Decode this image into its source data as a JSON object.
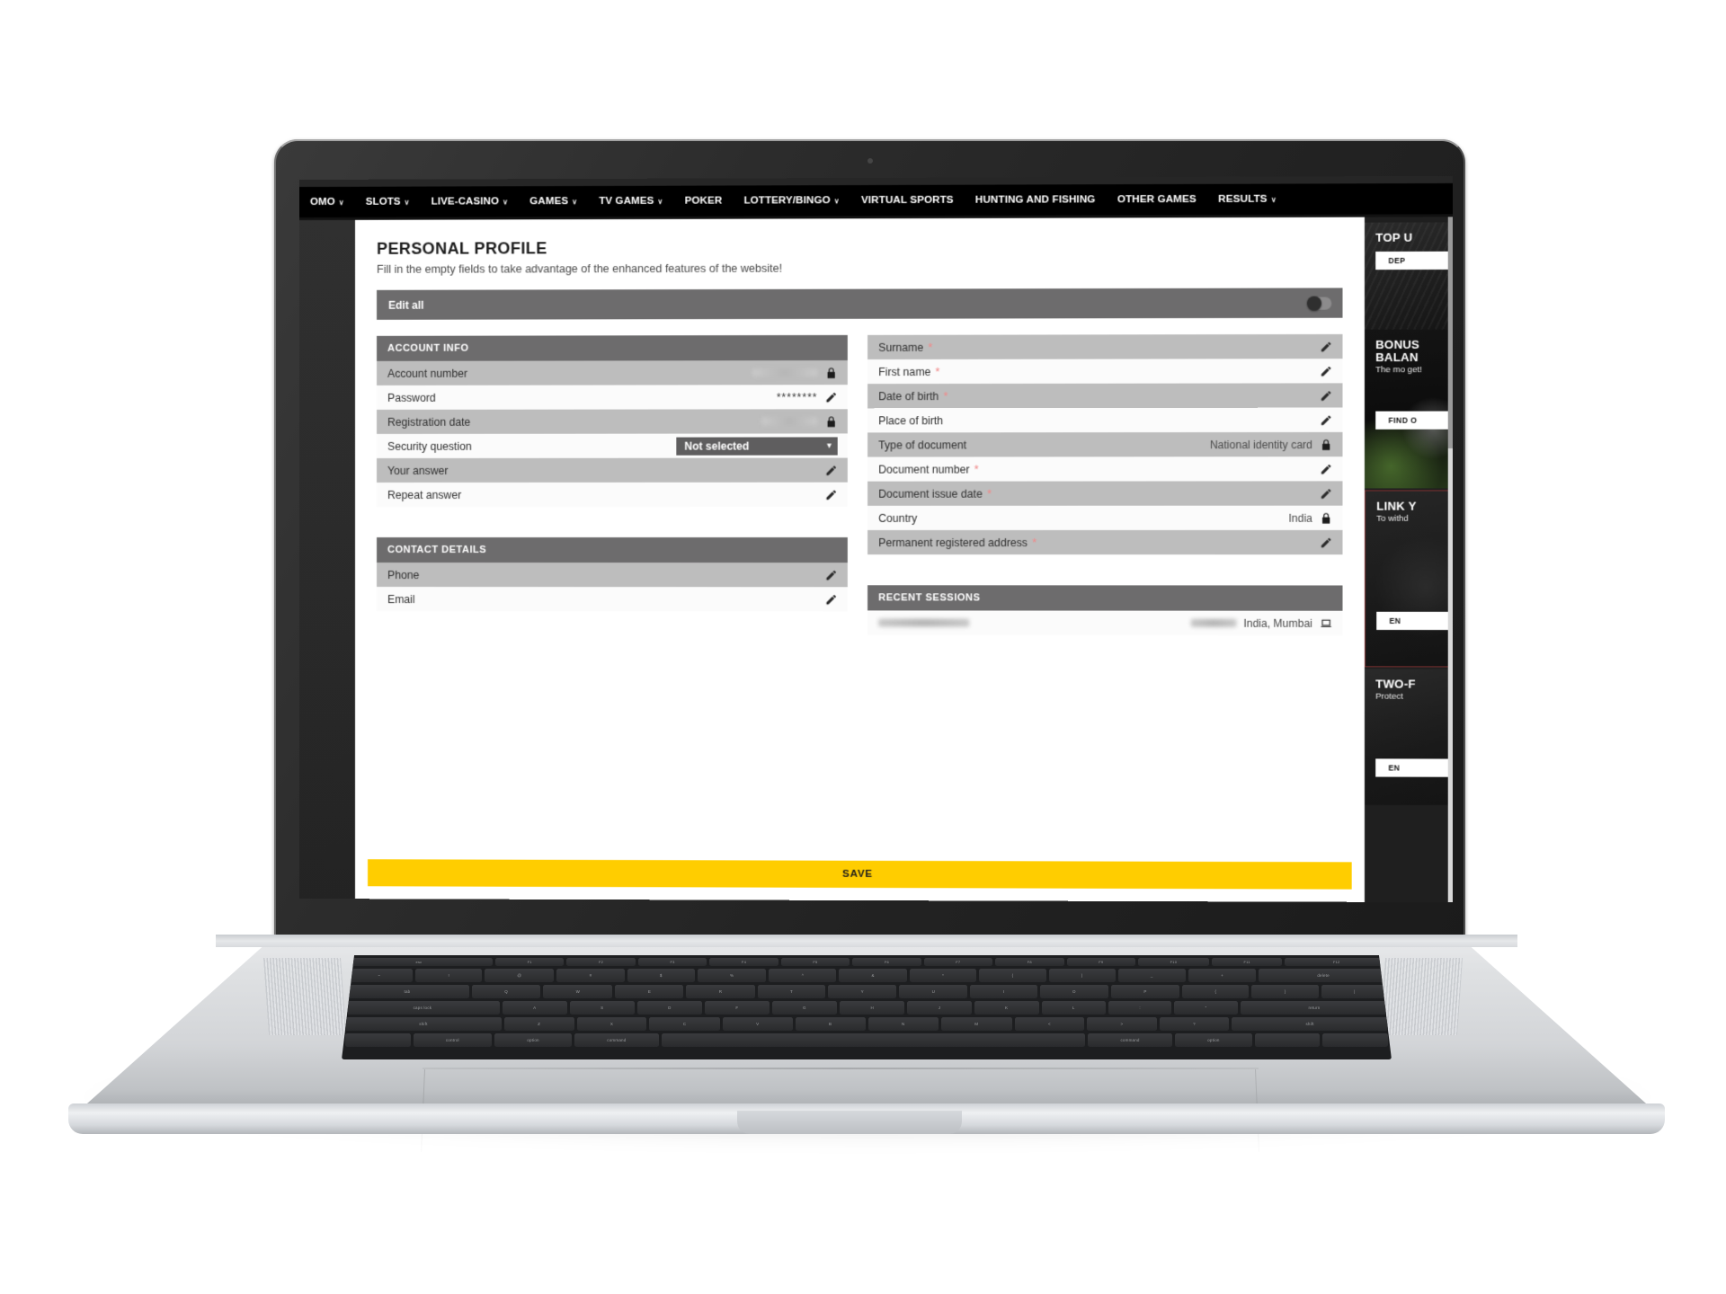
{
  "nav": {
    "items": [
      {
        "label": "OMO",
        "caret": true
      },
      {
        "label": "SLOTS",
        "caret": true
      },
      {
        "label": "LIVE-CASINO",
        "caret": true
      },
      {
        "label": "GAMES",
        "caret": true
      },
      {
        "label": "TV GAMES",
        "caret": true
      },
      {
        "label": "POKER",
        "caret": false
      },
      {
        "label": "LOTTERY/BINGO",
        "caret": true
      },
      {
        "label": "VIRTUAL SPORTS",
        "caret": false
      },
      {
        "label": "HUNTING AND FISHING",
        "caret": false
      },
      {
        "label": "OTHER GAMES",
        "caret": false
      },
      {
        "label": "RESULTS",
        "caret": true
      }
    ],
    "caret_glyph": "∨"
  },
  "profile": {
    "title": "PERSONAL PROFILE",
    "subtitle": "Fill in the empty fields to take advantage of the enhanced features of the website!",
    "edit_all_label": "Edit all",
    "save_label": "SAVE"
  },
  "account_info": {
    "heading": "ACCOUNT INFO",
    "rows": [
      {
        "label": "Account number",
        "value": "",
        "redacted": true,
        "icon": "lock-icon"
      },
      {
        "label": "Password",
        "value": "********",
        "redacted": false,
        "icon": "pencil-icon"
      },
      {
        "label": "Registration date",
        "value": "",
        "redacted": true,
        "icon": "lock-icon"
      },
      {
        "label": "Security question",
        "value": "Not selected",
        "redacted": false,
        "icon": "select-dropdown"
      },
      {
        "label": "Your answer",
        "value": "",
        "redacted": false,
        "icon": "pencil-icon"
      },
      {
        "label": "Repeat answer",
        "value": "",
        "redacted": false,
        "icon": "pencil-icon"
      }
    ],
    "security_question_selected": "Not selected"
  },
  "contact_details": {
    "heading": "CONTACT DETAILS",
    "rows": [
      {
        "label": "Phone",
        "value": "",
        "redacted": false,
        "icon": "pencil-icon"
      },
      {
        "label": "Email",
        "value": "",
        "redacted": false,
        "icon": "pencil-icon"
      }
    ]
  },
  "personal_details": {
    "rows": [
      {
        "label": "Surname",
        "required": true,
        "value": "",
        "redacted": false,
        "icon": "pencil-icon"
      },
      {
        "label": "First name",
        "required": true,
        "value": "",
        "redacted": false,
        "icon": "pencil-icon"
      },
      {
        "label": "Date of birth",
        "required": true,
        "value": "",
        "redacted": false,
        "icon": "pencil-icon"
      },
      {
        "label": "Place of birth",
        "required": false,
        "value": "",
        "redacted": false,
        "icon": "pencil-icon"
      },
      {
        "label": "Type of document",
        "required": false,
        "value": "National identity card",
        "redacted": false,
        "icon": "lock-icon"
      },
      {
        "label": "Document number",
        "required": true,
        "value": "",
        "redacted": false,
        "icon": "pencil-icon"
      },
      {
        "label": "Document issue date",
        "required": true,
        "value": "",
        "redacted": false,
        "icon": "pencil-icon"
      },
      {
        "label": "Country",
        "required": false,
        "value": "India",
        "redacted": false,
        "icon": "lock-icon"
      },
      {
        "label": "Permanent registered address",
        "required": true,
        "value": "",
        "redacted": false,
        "icon": "pencil-icon"
      }
    ]
  },
  "recent_sessions": {
    "heading": "RECENT SESSIONS",
    "rows": [
      {
        "datetime": "",
        "redacted_datetime": true,
        "ip": "",
        "redacted_ip": true,
        "location": "India, Mumbai",
        "icon": "laptop-icon"
      }
    ]
  },
  "promos": [
    {
      "name": "top-up",
      "heading": "TOP U",
      "sub": "",
      "button": "DEP"
    },
    {
      "name": "bonus-balance",
      "heading": "BONUS BALAN",
      "sub": "The mo get!",
      "button": "FIND O"
    },
    {
      "name": "link-account",
      "heading": "LINK Y",
      "sub": "To withd",
      "button": "EN"
    },
    {
      "name": "two-factor",
      "heading": "TWO-F",
      "sub": "Protect ",
      "button": "EN"
    }
  ],
  "colors": {
    "accent_yellow": "#ffcd00",
    "section_header": "#6d6c6d",
    "row_shade": "#bdbdbd",
    "row_plain": "#fbfbfb",
    "required_star": "#f08a8a",
    "nav_bg": "#000000"
  },
  "keyboard": {
    "fn_row": [
      "esc",
      "F1",
      "F2",
      "F3",
      "F4",
      "F5",
      "F6",
      "F7",
      "F8",
      "F9",
      "F10",
      "F11",
      "F12"
    ],
    "num_row": [
      "~",
      "!",
      "@",
      "#",
      "$",
      "%",
      "^",
      "&",
      "*",
      "(",
      ")",
      "_",
      "+",
      "delete"
    ],
    "q_row": [
      "tab",
      "Q",
      "W",
      "E",
      "R",
      "T",
      "Y",
      "U",
      "I",
      "O",
      "P",
      "{",
      "}",
      "|"
    ],
    "a_row": [
      "caps lock",
      "A",
      "S",
      "D",
      "F",
      "G",
      "H",
      "J",
      "K",
      "L",
      ":",
      "\"",
      "return"
    ],
    "z_row": [
      "shift",
      "Z",
      "X",
      "C",
      "V",
      "B",
      "N",
      "M",
      "<",
      ">",
      "?",
      "shift"
    ],
    "mod_row": [
      "",
      "control",
      "option",
      "command",
      "",
      "command",
      "option",
      "",
      ""
    ]
  }
}
